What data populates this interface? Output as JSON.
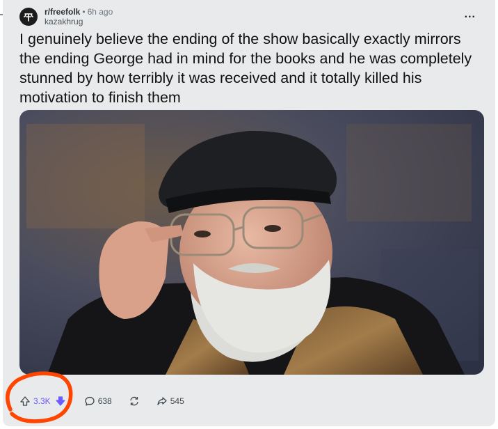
{
  "post": {
    "subreddit": "r/freefolk",
    "separator": "•",
    "time": "6h ago",
    "author": "kazakhrug",
    "more_label": "...",
    "title": "I genuinely believe the ending of the show basically exactly mirrors the ending George had in mind for the books and he was completely stunned by how terribly it was received and it totally killed his motivation to finish them"
  },
  "actions": {
    "score": "3.3K",
    "comments": "638",
    "shares": "545"
  },
  "icons": {
    "avatar": "subreddit-avatar-icon",
    "upvote": "upvote-icon",
    "downvote": "downvote-icon",
    "comment": "comment-icon",
    "crosspost": "crosspost-icon",
    "share": "share-icon"
  },
  "colors": {
    "card_background": "#e9eaeb",
    "downvote_active": "#6a5cff",
    "annotation": "#ff4500"
  }
}
